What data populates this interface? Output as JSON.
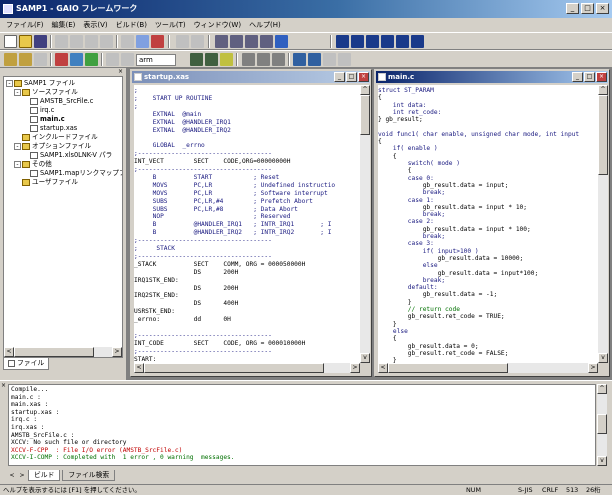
{
  "window": {
    "title": "SAMP1 - GAIO フレームワーク",
    "minimize": "_",
    "maximize": "□",
    "close": "×"
  },
  "menu": [
    "ファイル(F)",
    "編集(E)",
    "表示(V)",
    "ビルド(B)",
    "ツール(T)",
    "ウィンドウ(W)",
    "ヘルプ(H)"
  ],
  "toolbar": {
    "combo_value": "arm"
  },
  "project": {
    "close_glyph": "×",
    "tree": [
      {
        "label": "SAMP1 ファイル",
        "kind": "folder"
      },
      {
        "label": "ソースファイル",
        "kind": "folder"
      },
      {
        "label": "AMSTB_SrcFile.c",
        "kind": "file"
      },
      {
        "label": "irq.c",
        "kind": "file"
      },
      {
        "label": "main.c",
        "kind": "file"
      },
      {
        "label": "startup.xas",
        "kind": "file"
      },
      {
        "label": "インクルードファイル",
        "kind": "folder"
      },
      {
        "label": "オプションファイル",
        "kind": "folder"
      },
      {
        "label": "SAMP1.xls0LNK-V パラ",
        "kind": "file"
      },
      {
        "label": "その他",
        "kind": "folder"
      },
      {
        "label": "SAMP1.mapリンクマップファ",
        "kind": "file"
      },
      {
        "label": "ユーザファイル",
        "kind": "folder"
      }
    ],
    "tab_label": "ファイル"
  },
  "startup_window": {
    "title": "startup.xas",
    "lines": [
      {
        "t": ";",
        "c": "blue"
      },
      {
        "t": ";    START UP ROUTINE",
        "c": "blue"
      },
      {
        "t": ";",
        "c": "blue"
      },
      {
        "t": "     EXTNAL  @main",
        "c": "blue"
      },
      {
        "t": "     EXTNAL  @HANDLER_IRQ1",
        "c": "blue"
      },
      {
        "t": "     EXTNAL  @HANDLER_IRQ2",
        "c": "blue"
      },
      {
        "t": "",
        "c": "blue"
      },
      {
        "t": "     GLOBAL  _errno",
        "c": "blue"
      },
      {
        "t": ";------------------------------------",
        "c": "blue"
      },
      {
        "t": "INT_VECT        SECT    CODE,ORG=00000000H",
        "c": "black"
      },
      {
        "t": ";------------------------------------",
        "c": "blue"
      },
      {
        "t": "     B          START           ; Reset",
        "c": "blue"
      },
      {
        "t": "     MOVS       PC,LR           ; Undefined instructio",
        "c": "blue"
      },
      {
        "t": "     MOVS       PC,LR           ; Software interrupt",
        "c": "blue"
      },
      {
        "t": "     SUBS       PC,LR,#4        ; Prefetch Abort",
        "c": "blue"
      },
      {
        "t": "     SUBS       PC,LR,#8        ; Data Abort",
        "c": "blue"
      },
      {
        "t": "     NOP                        ; Reserved",
        "c": "blue"
      },
      {
        "t": "     B          @HANDLER_IRQ1   ; INTR_IRQ1       ; I",
        "c": "blue"
      },
      {
        "t": "     B          @HANDLER_IRQ2   ; INTR_IRQ2       ; I",
        "c": "blue"
      },
      {
        "t": ";------------------------------------",
        "c": "blue"
      },
      {
        "t": ";     STACK",
        "c": "blue"
      },
      {
        "t": ";------------------------------------",
        "c": "blue"
      },
      {
        "t": "_STACK          SECT    COMM, ORG = 000050000H",
        "c": "black"
      },
      {
        "t": "                DS      200H",
        "c": "black"
      },
      {
        "t": "IRQ1STK_END:",
        "c": "black"
      },
      {
        "t": "                DS      200H",
        "c": "black"
      },
      {
        "t": "IRQ2STK_END:",
        "c": "black"
      },
      {
        "t": "                DS      400H",
        "c": "black"
      },
      {
        "t": "USRSTK_END:",
        "c": "black"
      },
      {
        "t": "_errno:         dd      0H",
        "c": "black"
      },
      {
        "t": "",
        "c": "black"
      },
      {
        "t": ";------------------------------------",
        "c": "blue"
      },
      {
        "t": "INT_CODE        SECT    CODE, ORG = 000010000H",
        "c": "black"
      },
      {
        "t": ";------------------------------------",
        "c": "blue"
      },
      {
        "t": "START:",
        "c": "black"
      }
    ]
  },
  "main_window": {
    "title": "main.c",
    "lines": [
      {
        "t": "struct ST_PARAM",
        "c": "blue"
      },
      {
        "t": "{",
        "c": "black"
      },
      {
        "t": "    int data:",
        "c": "blue"
      },
      {
        "t": "    int ret_code:",
        "c": "blue"
      },
      {
        "t": "} gb_result;",
        "c": "black"
      },
      {
        "t": "",
        "c": "black"
      },
      {
        "t": "void func1( char enable, unsigned char mode, int input",
        "c": "blue"
      },
      {
        "t": "{",
        "c": "black"
      },
      {
        "t": "    if( enable )",
        "c": "blue"
      },
      {
        "t": "    {",
        "c": "black"
      },
      {
        "t": "        switch( mode )",
        "c": "blue"
      },
      {
        "t": "        {",
        "c": "black"
      },
      {
        "t": "        case 0:",
        "c": "blue"
      },
      {
        "t": "            gb_result.data = input;",
        "c": "black"
      },
      {
        "t": "            break;",
        "c": "blue"
      },
      {
        "t": "        case 1:",
        "c": "blue"
      },
      {
        "t": "            gb_result.data = input * 10;",
        "c": "black"
      },
      {
        "t": "            break;",
        "c": "blue"
      },
      {
        "t": "        case 2:",
        "c": "blue"
      },
      {
        "t": "            gb_result.data = input * 100;",
        "c": "black"
      },
      {
        "t": "            break;",
        "c": "blue"
      },
      {
        "t": "        case 3:",
        "c": "blue"
      },
      {
        "t": "            if( input>100 )",
        "c": "blue"
      },
      {
        "t": "                gb_result.data = 10000;",
        "c": "black"
      },
      {
        "t": "            else",
        "c": "blue"
      },
      {
        "t": "                gb_result.data = input*100;",
        "c": "black"
      },
      {
        "t": "            break;",
        "c": "blue"
      },
      {
        "t": "        default:",
        "c": "blue"
      },
      {
        "t": "            gb_result.data = -1;",
        "c": "black"
      },
      {
        "t": "        }",
        "c": "black"
      },
      {
        "t": "        // return code",
        "c": "green"
      },
      {
        "t": "        gb_result.ret_code = TRUE;",
        "c": "black"
      },
      {
        "t": "    }",
        "c": "black"
      },
      {
        "t": "    else",
        "c": "blue"
      },
      {
        "t": "    {",
        "c": "black"
      },
      {
        "t": "        gb_result.data = 0;",
        "c": "black"
      },
      {
        "t": "        gb_result.ret_code = FALSE;",
        "c": "black"
      },
      {
        "t": "    }",
        "c": "black"
      }
    ]
  },
  "output": {
    "close_glyph": "×",
    "lines": [
      {
        "t": "Compile...",
        "c": "black"
      },
      {
        "t": "main.c :",
        "c": "black"
      },
      {
        "t": "main.xas :",
        "c": "black"
      },
      {
        "t": "startup.xas :",
        "c": "black"
      },
      {
        "t": "irq.c :",
        "c": "black"
      },
      {
        "t": "irq.xas :",
        "c": "black"
      },
      {
        "t": "AMSTB_SrcFile.c :",
        "c": "black"
      },
      {
        "t": "XCCV: No such file or directory",
        "c": "black"
      },
      {
        "t": "XCCV-F-CPP  : File I/O error (AMSTB_SrcFile.c)",
        "c": "red"
      },
      {
        "t": "XCCV-I-COMP : Completed with  1 error , 0 warning  messages.",
        "c": "green"
      }
    ],
    "tabs": [
      "ビルド",
      "ファイル検索"
    ]
  },
  "statusbar": {
    "help": "ヘルプを表示するには [F1] を押してください。",
    "num": "NUM",
    "encoding": "S-JIS",
    "line_ending": "CRLF",
    "position": "513",
    "column": "26桁"
  }
}
